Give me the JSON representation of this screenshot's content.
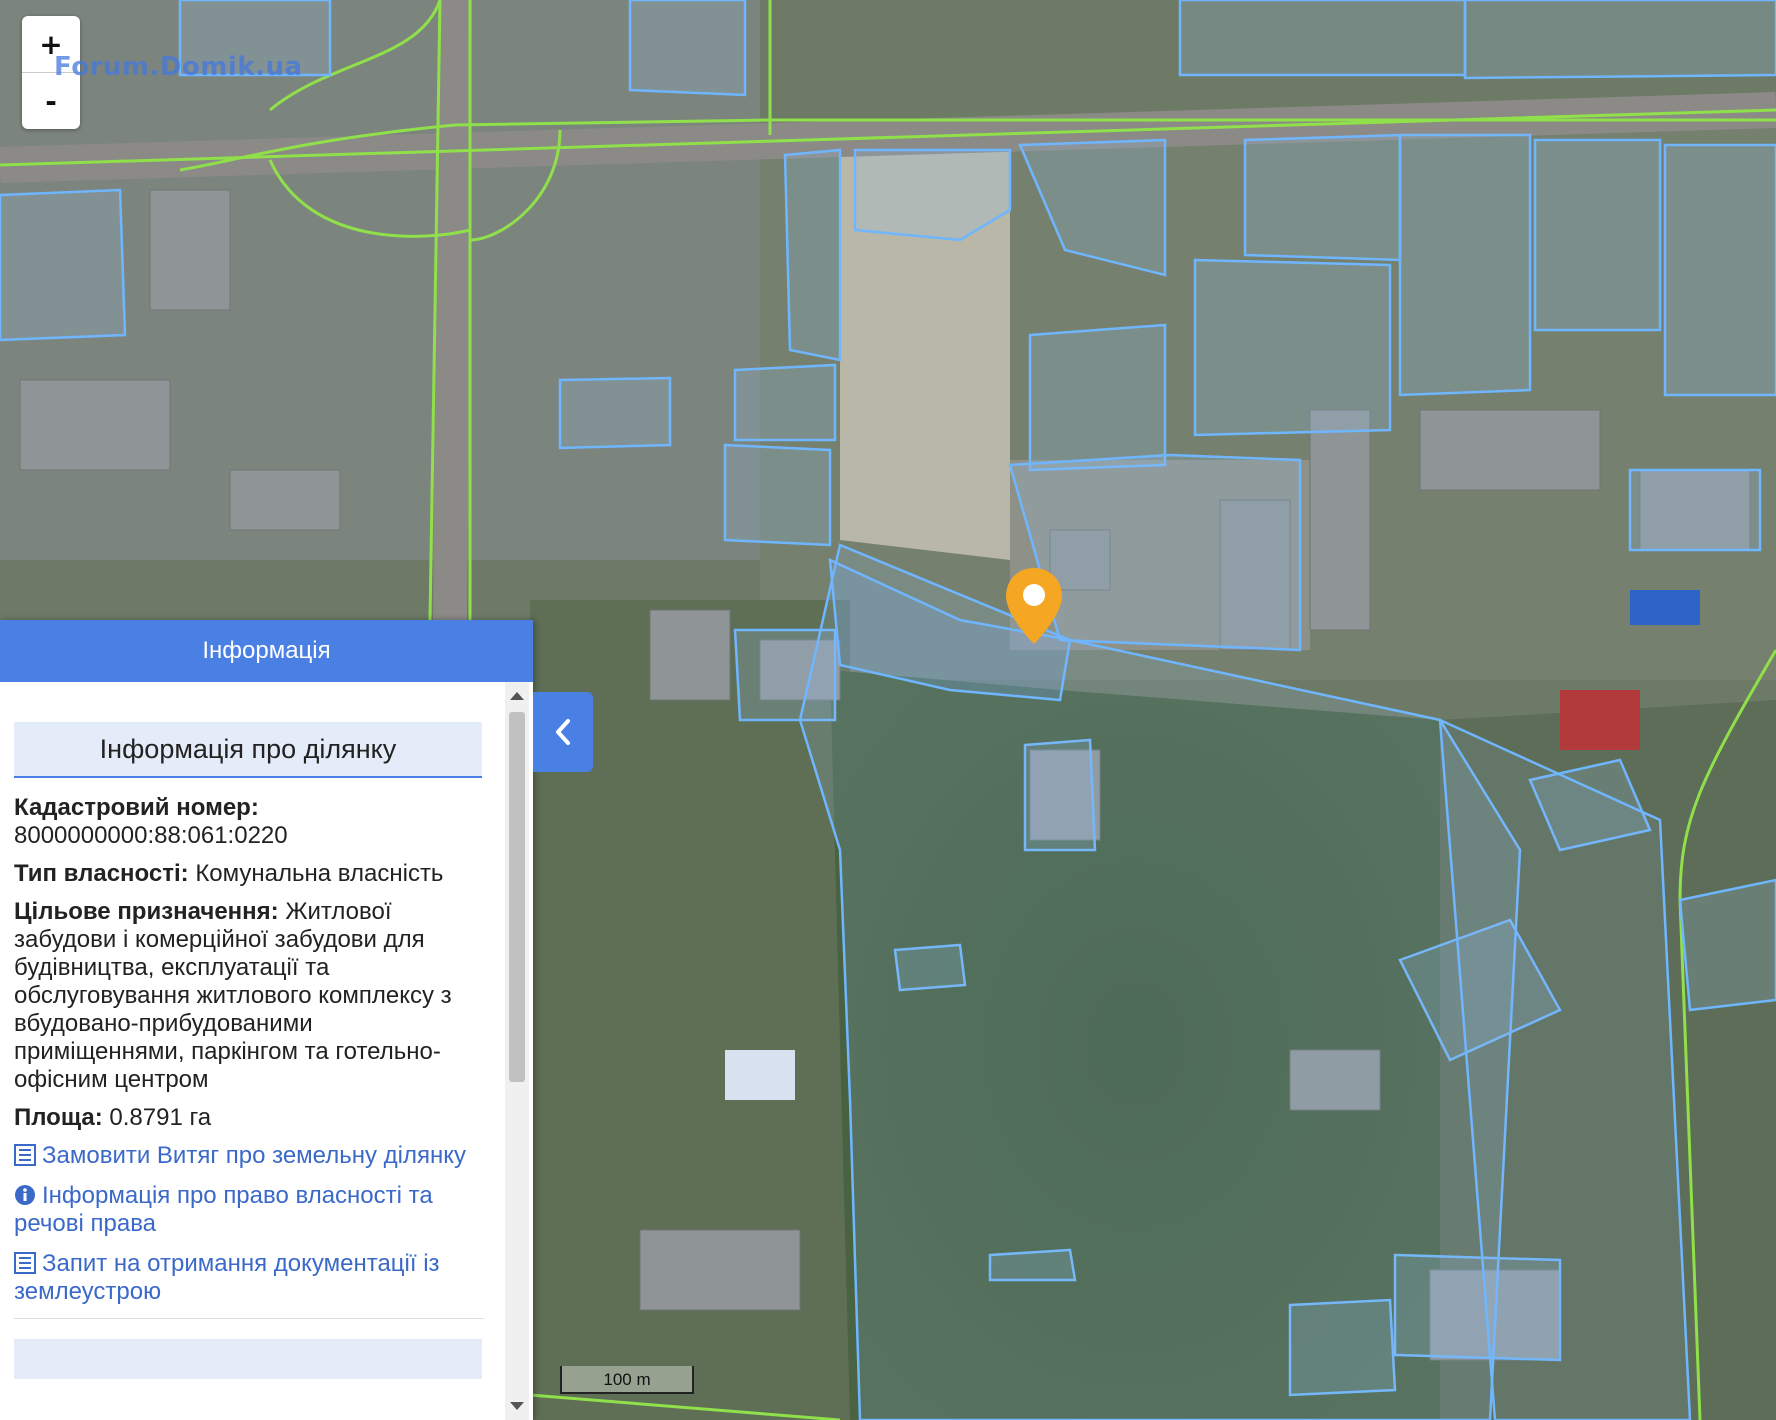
{
  "map": {
    "zoom_in": "+",
    "zoom_out": "-",
    "watermark": "Forum.Domik.ua",
    "scale_label": "100 m"
  },
  "panel": {
    "header": "Інформація",
    "section_title": "Інформація про ділянку",
    "cadastral_label": "Кадастровий номер:",
    "cadastral_value": "8000000000:88:061:0220",
    "ownership_label": "Тип власності:",
    "ownership_value": "Комунальна власність",
    "purpose_label": "Цільове призначення:",
    "purpose_value": "Житлової забудови і комерційної забудови для будівництва, експлуатації та обслуговування житлового комплексу з вбудовано-прибудованими приміщеннями, паркінгом та готельно-офісним центром",
    "area_label": "Площа:",
    "area_value": "0.8791 га",
    "links": [
      {
        "icon": "list-icon",
        "label": "Замовити Витяг про земельну ділянку"
      },
      {
        "icon": "info-circle-icon",
        "label": "Інформація про право власності та речові права"
      },
      {
        "icon": "list-icon",
        "label": "Запит на отримання документації із землеустрою"
      }
    ],
    "collapse_icon": "chevron-left-icon"
  },
  "colors": {
    "parcel_outline": "#6fb6ff",
    "road_line": "#8fe04a",
    "panel_accent": "#4a7fe3",
    "marker": "#f5a623"
  }
}
